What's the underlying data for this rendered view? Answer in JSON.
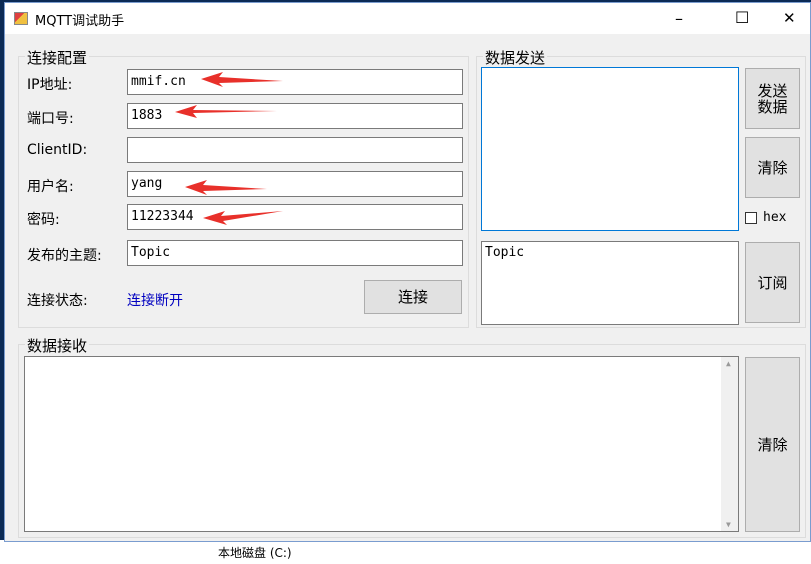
{
  "window": {
    "title": "MQTT调试助手",
    "minimize": "–",
    "maximize": "☐",
    "close": "✕"
  },
  "connection": {
    "group_label": "连接配置",
    "ip_label": "IP地址:",
    "ip_value": "mmif.cn",
    "port_label": "端口号:",
    "port_value": "1883",
    "clientid_label": "ClientID:",
    "clientid_value": "",
    "user_label": "用户名:",
    "user_value": "yang",
    "password_label": "密码:",
    "password_value": "11223344",
    "topic_label": "发布的主题:",
    "topic_value": "Topic",
    "status_label": "连接状态:",
    "status_value": "连接断开",
    "connect_button": "连接"
  },
  "send": {
    "group_label": "数据发送",
    "send_button": "发送数据",
    "clear_button": "清除",
    "hex_label": "hex",
    "hex_checked": false,
    "subscribe_topic": "Topic",
    "subscribe_button": "订阅"
  },
  "receive": {
    "group_label": "数据接收",
    "clear_button": "清除"
  },
  "background": {
    "taskbar_item": "本地磁盘 (C:)"
  },
  "colors": {
    "status": "#0000c0",
    "arrow": "#e8302a",
    "focus_border": "#0078d7"
  }
}
